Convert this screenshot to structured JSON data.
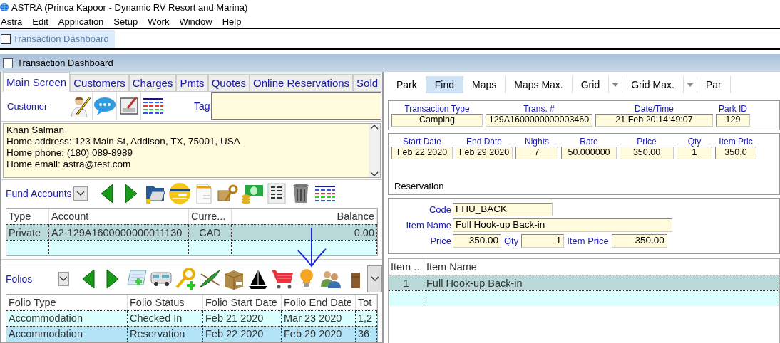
{
  "app": {
    "title": "ASTRA (Princa Kapoor - Dynamic RV Resort and Marina)"
  },
  "menu": [
    "Astra",
    "Edit",
    "Application",
    "Setup",
    "Work",
    "Window",
    "Help"
  ],
  "mdi_tabs": [
    {
      "label": "Transaction Dashboard",
      "selected": true
    }
  ],
  "window": {
    "title": "Transaction Dashboard"
  },
  "tabs": [
    {
      "label": "Main Screen",
      "selected": true
    },
    {
      "label": "Customers",
      "selected": false
    },
    {
      "label": "Charges",
      "selected": false
    },
    {
      "label": "Pmts",
      "selected": false
    },
    {
      "label": "Quotes",
      "selected": false
    },
    {
      "label": "Online Reservations",
      "selected": false
    },
    {
      "label": "Sold",
      "selected": false
    }
  ],
  "customer": {
    "label": "Customer",
    "tag_label": "Tag",
    "details": [
      "Khan Salman",
      "Home address: 123 Main St, Addison, TX, 75001, USA",
      "Home phone: (180) 089-8989",
      "Home email: astra@test.com"
    ]
  },
  "fund_accounts": {
    "label": "Fund Accounts",
    "columns": [
      "Type",
      "Account",
      "Curre...",
      "Balance"
    ],
    "rows": [
      {
        "cells": [
          "Private",
          "A2-129A1600000000011130",
          "CAD",
          "0.00"
        ],
        "selected": true
      }
    ]
  },
  "folios": {
    "label": "Folios",
    "columns": [
      "Folio Type",
      "Folio Status",
      "Folio Start Date",
      "Folio End Date",
      "Tot"
    ],
    "rows": [
      {
        "cells": [
          "Accommodation",
          "Checked In",
          "Feb 21 2020",
          "Mar 23 2020",
          "1,2"
        ],
        "selected": false
      },
      {
        "cells": [
          "Accommodation",
          "Reservation",
          "Feb 22 2020",
          "Feb 29 2020",
          "36"
        ],
        "selected": true
      }
    ]
  },
  "toolbar": [
    {
      "label": "Park",
      "selected": false,
      "has_menu": false
    },
    {
      "label": "Find",
      "selected": true,
      "has_menu": false
    },
    {
      "label": "Maps",
      "selected": false,
      "has_menu": false
    },
    {
      "label": "Maps Max.",
      "selected": false,
      "has_menu": false
    },
    {
      "label": "Grid",
      "selected": false,
      "has_menu": true
    },
    {
      "label": "Grid Max.",
      "selected": false,
      "has_menu": true
    },
    {
      "label": "Par",
      "selected": false,
      "has_menu": false
    }
  ],
  "transaction": [
    {
      "label": "Transaction Type",
      "value": "Camping"
    },
    {
      "label": "Trans. #",
      "value": "129A1600000000003460"
    },
    {
      "label": "Date/Time",
      "value": "21 Feb 20  14:49:07"
    },
    {
      "label": "Park ID",
      "value": "129"
    }
  ],
  "reservation_fields": [
    {
      "label": "Start Date",
      "value": "Feb 22 2020"
    },
    {
      "label": "End Date",
      "value": "Feb 29 2020"
    },
    {
      "label": "Nights",
      "value": "7"
    },
    {
      "label": "Rate",
      "value": "50.000000"
    },
    {
      "label": "Price",
      "value": "350.00"
    },
    {
      "label": "Qty",
      "value": "1"
    },
    {
      "label": "Item Pric",
      "value": "350.0"
    }
  ],
  "reservation_note": "Reservation",
  "item": {
    "code_label": "Code",
    "code": "FHU_BACK",
    "name_label": "Item Name",
    "name": "Full Hook-up Back-in",
    "price_label": "Price",
    "price": "350.00",
    "qty_label": "Qty",
    "qty": "1",
    "item_price_label": "Item Price",
    "item_price": "350.00"
  },
  "items_table": {
    "columns": [
      "Item ...",
      "Item Name"
    ],
    "rows": [
      {
        "cells": [
          "1",
          "Full Hook-up Back-in"
        ],
        "selected": true
      }
    ]
  }
}
